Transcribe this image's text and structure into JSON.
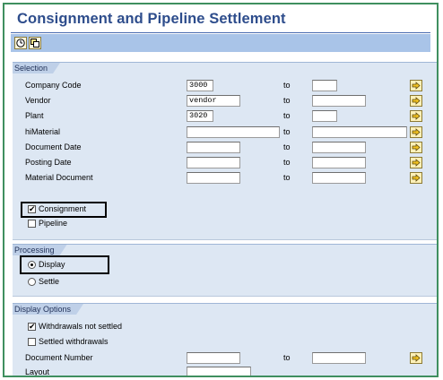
{
  "title": "Consignment and Pipeline Settlement",
  "toolbar": {
    "buttons": [
      {
        "icon": "execute-clock-icon"
      },
      {
        "icon": "copy-variant-icon"
      }
    ]
  },
  "selection": {
    "header": "Selection",
    "to_label": "to",
    "rows": [
      {
        "label": "Company Code",
        "from": "3000",
        "to": ""
      },
      {
        "label": "Vendor",
        "from": "vendor",
        "to": ""
      },
      {
        "label": "Plant",
        "from": "3020",
        "to": ""
      },
      {
        "label": "hiMaterial",
        "from": "",
        "to": ""
      },
      {
        "label": "Document Date",
        "from": "",
        "to": ""
      },
      {
        "label": "Posting Date",
        "from": "",
        "to": ""
      },
      {
        "label": "Material Document",
        "from": "",
        "to": ""
      }
    ],
    "consignment": {
      "label": "Consignment",
      "checked": true
    },
    "pipeline": {
      "label": "Pipeline",
      "checked": false
    }
  },
  "processing": {
    "header": "Processing",
    "display": {
      "label": "Display",
      "selected": true
    },
    "settle": {
      "label": "Settle",
      "selected": false
    }
  },
  "display_options": {
    "header": "Display Options",
    "withdrawals_not_settled": {
      "label": "Withdrawals not settled",
      "checked": true
    },
    "settled_withdrawals": {
      "label": "Settled withdrawals",
      "checked": false
    },
    "document_number": {
      "label": "Document Number",
      "from": "",
      "to": "",
      "to_label": "to"
    },
    "layout": {
      "label": "Layout",
      "value": ""
    }
  },
  "colors": {
    "title": "#2e4d8c",
    "toolbar": "#a9c4e8",
    "section_bg": "#dde7f3",
    "frame": "#3f8f5f",
    "arrow_button": "#fff1b8"
  }
}
